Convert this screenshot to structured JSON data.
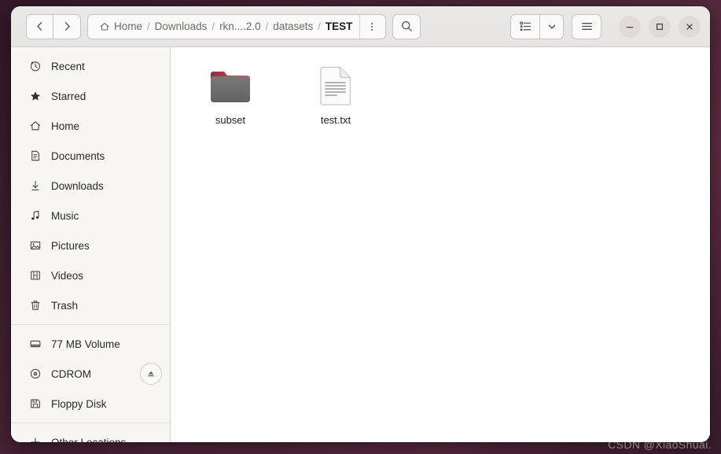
{
  "window": {
    "controls": {
      "minimize": "–",
      "maximize": "▢",
      "close": "✕"
    }
  },
  "header": {
    "nav": {
      "back_icon": "chevron-left-icon",
      "forward_icon": "chevron-right-icon"
    },
    "breadcrumbs": [
      {
        "label": "Home",
        "icon": "home-icon",
        "current": false
      },
      {
        "label": "Downloads",
        "icon": "",
        "current": false
      },
      {
        "label": "rkn....2.0",
        "icon": "",
        "current": false
      },
      {
        "label": "datasets",
        "icon": "",
        "current": false
      },
      {
        "label": "TEST",
        "icon": "",
        "current": true
      }
    ],
    "separator": "/",
    "path_menu_icon": "vertical-dots-icon",
    "search_icon": "search-icon",
    "view_list_icon": "list-view-icon",
    "view_dropdown_icon": "chevron-down-icon",
    "menu_icon": "hamburger-menu-icon"
  },
  "sidebar": {
    "groups": [
      {
        "items": [
          {
            "label": "Recent",
            "icon": "clock-icon"
          },
          {
            "label": "Starred",
            "icon": "star-icon"
          },
          {
            "label": "Home",
            "icon": "home-icon"
          },
          {
            "label": "Documents",
            "icon": "document-icon"
          },
          {
            "label": "Downloads",
            "icon": "download-arrow-icon"
          },
          {
            "label": "Music",
            "icon": "music-note-icon"
          },
          {
            "label": "Pictures",
            "icon": "picture-icon"
          },
          {
            "label": "Videos",
            "icon": "film-icon"
          },
          {
            "label": "Trash",
            "icon": "trash-icon"
          }
        ]
      },
      {
        "items": [
          {
            "label": "77 MB Volume",
            "icon": "drive-icon"
          },
          {
            "label": "CDROM",
            "icon": "disc-icon",
            "eject": true,
            "eject_icon": "eject-icon"
          },
          {
            "label": "Floppy Disk",
            "icon": "floppy-icon"
          }
        ]
      },
      {
        "items": [
          {
            "label": "Other Locations",
            "icon": "plus-icon"
          }
        ]
      }
    ]
  },
  "content": {
    "files": [
      {
        "name": "subset",
        "type": "folder"
      },
      {
        "name": "test.txt",
        "type": "text-file"
      }
    ]
  },
  "watermark": {
    "text": "CSDN @XiaoShuai."
  },
  "colors": {
    "desktop": "#3d1d2e",
    "headerbar": "#e9e7e5",
    "sidebar": "#f7f6f5",
    "content": "#ffffff",
    "folder_tab_start": "#8e2a52",
    "folder_tab_end": "#ef6a20",
    "folder_body": "#6e6e6e",
    "text": "#2b2826"
  }
}
